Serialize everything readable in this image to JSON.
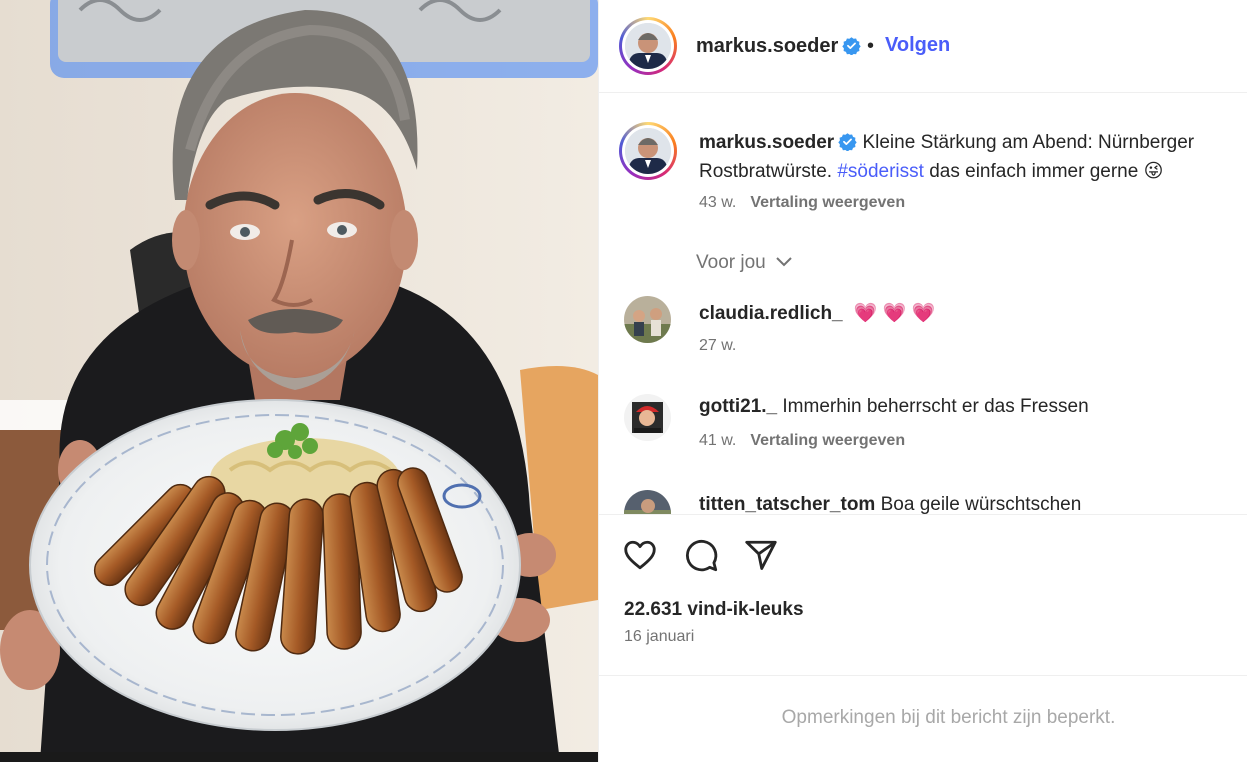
{
  "post": {
    "username": "markus.soeder",
    "follow_label": "Volgen",
    "separator": "•",
    "caption_text": "Kleine Stärkung am Abend: Nürnberger Rostbratwürste.",
    "caption_hashtag": "#söderisst",
    "caption_tail": "das einfach immer gerne",
    "caption_emoji": "😜",
    "caption_age": "43 w.",
    "translation_label": "Vertaling weergeven",
    "sort_label": "Voor jou",
    "likes": "22.631 vind-ik-leuks",
    "date": "16 januari",
    "comments_restricted": "Opmerkingen bij dit bericht zijn beperkt."
  },
  "comments": [
    {
      "username": "claudia.redlich_",
      "text": "💗 💗 💗",
      "age": "27 w.",
      "translation_label": ""
    },
    {
      "username": "gotti21._",
      "text": "Immerhin beherrscht er das Fressen",
      "age": "41 w.",
      "translation_label": "Vertaling weergeven"
    },
    {
      "username": "titten_tatscher_tom",
      "text": "Boa geile würschtschen",
      "age": "",
      "translation_label": ""
    }
  ],
  "icons": {
    "verified": "verified-badge-icon",
    "like": "heart-icon",
    "comment": "comment-bubble-icon",
    "share": "paper-plane-icon",
    "sort": "chevron-down-icon"
  },
  "colors": {
    "link_blue": "#4a5df9",
    "verified_blue": "#3897f0",
    "muted_gray": "#737373",
    "text_dark": "#262626",
    "heart_pink": "#e8336b"
  }
}
